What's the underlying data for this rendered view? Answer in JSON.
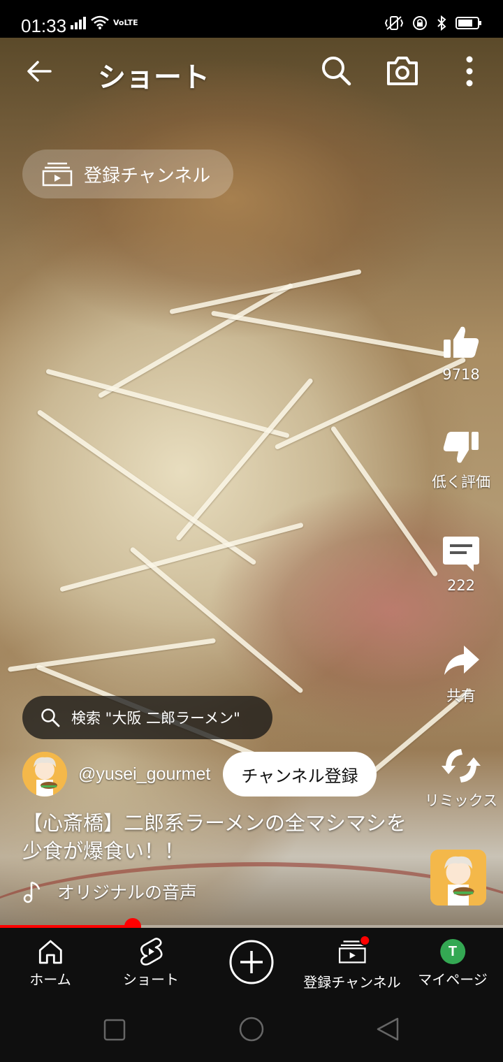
{
  "status_bar": {
    "time": "01:33",
    "network": "VoLTE"
  },
  "header": {
    "title": "ショート"
  },
  "subscriptions_pill": {
    "label": "登録チャンネル"
  },
  "actions": {
    "like_count": "9718",
    "dislike_label": "低く評価",
    "comment_count": "222",
    "share_label": "共有",
    "remix_label": "リミックス"
  },
  "search_suggestion": {
    "text": "検索 \"大阪 二郎ラーメン\""
  },
  "channel": {
    "handle": "@yusei_gourmet",
    "subscribe_label": "チャンネル登録"
  },
  "video": {
    "title": "【心斎橋】二郎系ラーメンの全マシマシを少食が爆食い！！",
    "audio_label": "オリジナルの音声",
    "progress": 0.264
  },
  "bottom_nav": {
    "items": [
      {
        "label": "ホーム",
        "icon": "home-icon"
      },
      {
        "label": "ショート",
        "icon": "shorts-icon"
      },
      {
        "label": "",
        "icon": "create-icon"
      },
      {
        "label": "登録チャンネル",
        "icon": "subscriptions-icon"
      },
      {
        "label": "マイページ",
        "icon": "avatar"
      }
    ],
    "avatar_letter": "T"
  },
  "colors": {
    "accent_red": "#ff0000",
    "nav_bg": "#0f0f0f",
    "avatar_green": "#34a853",
    "thumb_orange": "#f4b84a"
  }
}
